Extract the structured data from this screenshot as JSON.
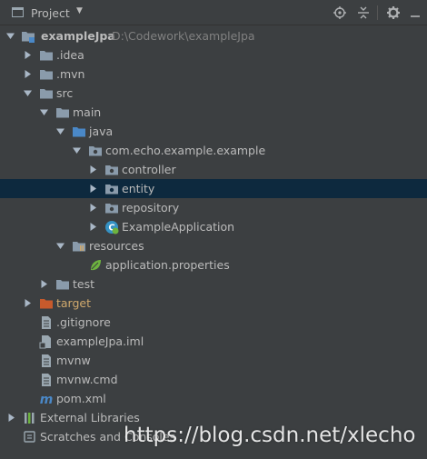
{
  "panel": {
    "title": "Project",
    "dropdown_glyph": "▼"
  },
  "toolbar": {
    "icons": [
      "locate-icon",
      "collapse-all-icon",
      "gear-icon",
      "hide-icon"
    ]
  },
  "tree": {
    "root": {
      "label": "exampleJpa",
      "path": "D:\\Codework\\exampleJpa"
    },
    "idea": "idea",
    "mvn": "mvn",
    "src": "src",
    "main": "main",
    "java": "java",
    "package": "com.echo.example.example",
    "controller": "controller",
    "entity": "entity",
    "repository": "repository",
    "example_application": "ExampleApplication",
    "resources": "resources",
    "application_properties": "application.properties",
    "test": "test",
    "target": "target",
    "gitignore": ".gitignore",
    "iml": "exampleJpa.iml",
    "mvnw": "mvnw",
    "mvnw_cmd": "mvnw.cmd",
    "pom": "pom.xml",
    "external_libraries": "External Libraries",
    "scratches": "Scratches and Consoles"
  },
  "watermark": "https://blog.csdn.net/xlecho",
  "colors": {
    "background": "#3c3f41",
    "selection": "#0d293e",
    "folder": "#8a9bab",
    "source_folder": "#4a88c7",
    "excluded_folder": "#c75a2c",
    "text": "#bbbbbb",
    "muted_text": "#808080"
  }
}
